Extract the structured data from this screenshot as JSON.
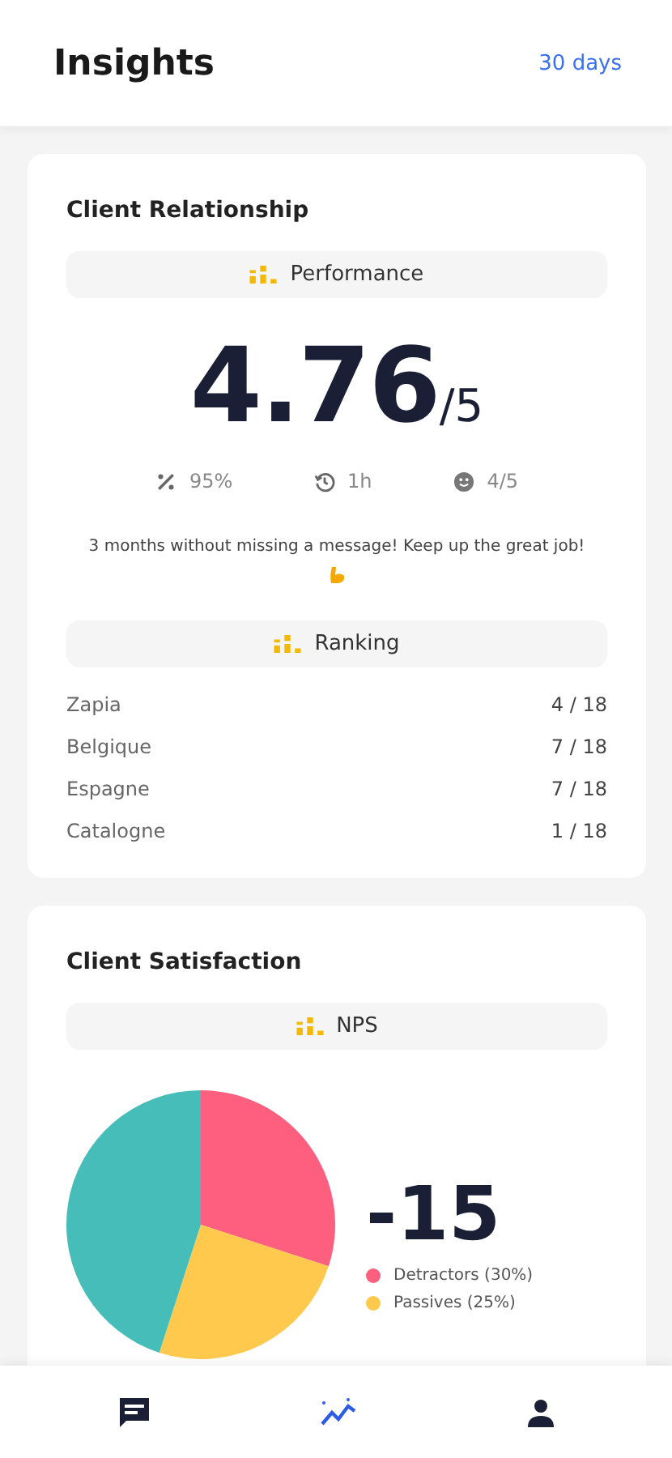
{
  "header": {
    "title": "Insights",
    "period": "30 days"
  },
  "client_relationship": {
    "title": "Client Relationship",
    "section": "Performance",
    "score": "4.76",
    "score_max": "/5",
    "stats": [
      {
        "kind": "percent",
        "value": "95%"
      },
      {
        "kind": "time",
        "value": "1h"
      },
      {
        "kind": "smile",
        "value": "4/5"
      }
    ],
    "message": "3 months without missing a message! Keep up the great job!",
    "ranking_title": "Ranking",
    "rankings": [
      {
        "name": "Zapia",
        "rank": "4 / 18"
      },
      {
        "name": "Belgique",
        "rank": "7 / 18"
      },
      {
        "name": "Espagne",
        "rank": "7 / 18"
      },
      {
        "name": "Catalogne",
        "rank": "1 / 18"
      }
    ]
  },
  "client_satisfaction": {
    "title": "Client Satisfaction",
    "section": "NPS",
    "score": "-15",
    "chart_data": {
      "type": "pie",
      "categories": [
        "Detractors (30%)",
        "Passives (25%)",
        null
      ],
      "values": [
        30,
        25,
        45
      ],
      "colors": [
        "#ff5f7e",
        "#ffc94d",
        "#46bdb8"
      ]
    }
  },
  "nav": [
    {
      "kind": "chat",
      "selected": false
    },
    {
      "kind": "trend",
      "selected": true
    },
    {
      "kind": "person",
      "selected": false
    }
  ]
}
